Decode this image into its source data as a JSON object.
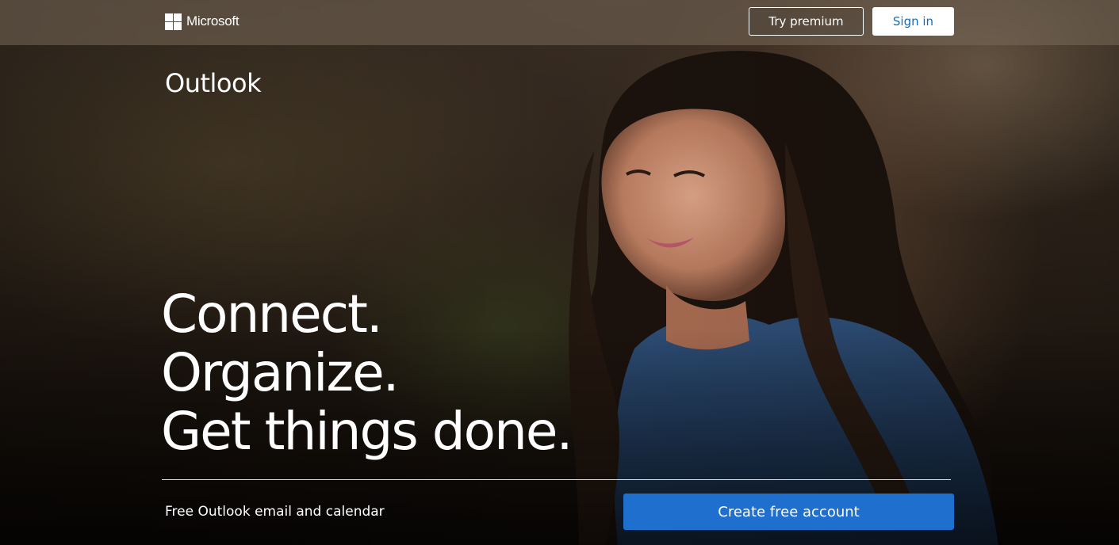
{
  "header": {
    "brand_name": "Microsoft",
    "try_premium_label": "Try premium",
    "sign_in_label": "Sign in"
  },
  "hero": {
    "product_title": "Outlook",
    "headline_lines": [
      "Connect.",
      "Organize.",
      "Get things done."
    ],
    "tagline": "Free Outlook email and calendar",
    "create_account_label": "Create free account"
  },
  "colors": {
    "accent_blue": "#1f6fcf",
    "sign_in_text": "#0f6cbd",
    "topbar_bg": "#786a5a"
  },
  "icons": {
    "brand_logo": "microsoft-logo-icon"
  }
}
